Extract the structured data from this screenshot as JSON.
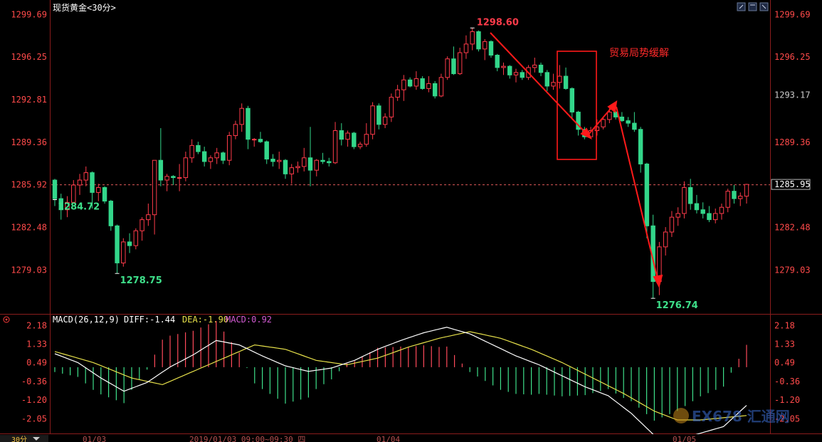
{
  "chart_data": [
    {
      "type": "candlestick",
      "title": "现货黄金<30分>",
      "ylim": [
        1276.0,
        1300.4
      ],
      "y_ticks": [
        "1299.69",
        "1296.25",
        "1292.81",
        "1289.36",
        "1285.92",
        "1282.48",
        "1279.03"
      ],
      "y_tick_values": [
        1299.69,
        1296.25,
        1292.81,
        1289.36,
        1285.92,
        1282.48,
        1279.03
      ],
      "right_ticks": [
        "1299.69",
        "1296.25",
        "1293.17",
        "1289.36",
        "1285.92",
        "1282.48",
        "1279.03"
      ],
      "right_tick_values": [
        1299.69,
        1296.25,
        1293.17,
        1289.36,
        1285.92,
        1282.48,
        1279.03
      ],
      "reference_value": 1285.92,
      "current_price": "1285.95",
      "current_price_value": 1285.95,
      "candles": [
        [
          1286.3,
          1286.4,
          1284.2,
          1284.8
        ],
        [
          1284.8,
          1285.2,
          1283.1,
          1283.9
        ],
        [
          1283.9,
          1285.0,
          1283.3,
          1284.5
        ],
        [
          1284.5,
          1286.3,
          1284.4,
          1285.9
        ],
        [
          1285.9,
          1286.8,
          1285.1,
          1286.3
        ],
        [
          1286.3,
          1287.4,
          1285.8,
          1286.9
        ],
        [
          1286.9,
          1287.0,
          1284.0,
          1285.3
        ],
        [
          1285.3,
          1286.0,
          1284.6,
          1285.7
        ],
        [
          1285.7,
          1285.8,
          1284.4,
          1284.6
        ],
        [
          1284.6,
          1284.7,
          1282.2,
          1282.6
        ],
        [
          1282.6,
          1282.7,
          1278.75,
          1279.6
        ],
        [
          1279.6,
          1281.6,
          1279.3,
          1281.3
        ],
        [
          1281.3,
          1282.0,
          1280.4,
          1281.0
        ],
        [
          1281.0,
          1282.4,
          1280.7,
          1282.2
        ],
        [
          1282.2,
          1283.3,
          1281.4,
          1283.1
        ],
        [
          1283.1,
          1284.4,
          1282.6,
          1283.5
        ],
        [
          1283.5,
          1286.4,
          1281.9,
          1287.9
        ],
        [
          1287.9,
          1290.5,
          1285.8,
          1286.3
        ],
        [
          1286.3,
          1286.8,
          1285.4,
          1286.6
        ],
        [
          1286.6,
          1286.7,
          1285.9,
          1286.5
        ],
        [
          1286.5,
          1287.6,
          1285.4,
          1286.5
        ],
        [
          1286.5,
          1288.6,
          1286.2,
          1288.1
        ],
        [
          1288.1,
          1289.6,
          1287.7,
          1289.1
        ],
        [
          1289.1,
          1289.4,
          1288.4,
          1288.6
        ],
        [
          1288.6,
          1289.0,
          1287.4,
          1287.8
        ],
        [
          1287.8,
          1288.3,
          1287.2,
          1288.1
        ],
        [
          1288.1,
          1288.9,
          1287.6,
          1288.5
        ],
        [
          1288.5,
          1288.6,
          1287.6,
          1287.9
        ],
        [
          1287.9,
          1290.2,
          1287.5,
          1289.9
        ],
        [
          1289.9,
          1291.1,
          1289.6,
          1290.8
        ],
        [
          1290.8,
          1292.5,
          1290.2,
          1292.1
        ],
        [
          1292.1,
          1292.3,
          1288.8,
          1289.6
        ],
        [
          1289.6,
          1289.7,
          1289.0,
          1289.6
        ],
        [
          1289.6,
          1290.2,
          1289.3,
          1289.4
        ],
        [
          1289.4,
          1289.5,
          1287.6,
          1288.0
        ],
        [
          1288.0,
          1288.4,
          1287.4,
          1287.8
        ],
        [
          1287.8,
          1288.6,
          1287.2,
          1287.9
        ],
        [
          1287.9,
          1288.0,
          1286.4,
          1286.8
        ],
        [
          1286.8,
          1287.6,
          1286.0,
          1287.3
        ],
        [
          1287.3,
          1287.8,
          1286.9,
          1287.4
        ],
        [
          1287.4,
          1288.9,
          1287.0,
          1288.1
        ],
        [
          1288.1,
          1290.6,
          1285.8,
          1287.1
        ],
        [
          1287.1,
          1288.0,
          1286.6,
          1287.9
        ],
        [
          1287.9,
          1288.5,
          1287.6,
          1287.8
        ],
        [
          1287.8,
          1288.1,
          1287.4,
          1287.7
        ],
        [
          1287.7,
          1291.0,
          1287.6,
          1290.3
        ],
        [
          1290.3,
          1290.9,
          1289.1,
          1289.6
        ],
        [
          1289.6,
          1290.3,
          1289.0,
          1290.1
        ],
        [
          1290.1,
          1290.2,
          1288.8,
          1289.0
        ],
        [
          1289.0,
          1289.4,
          1288.8,
          1289.2
        ],
        [
          1289.2,
          1290.9,
          1289.0,
          1290.0
        ],
        [
          1290.0,
          1292.6,
          1289.6,
          1292.3
        ],
        [
          1292.3,
          1292.5,
          1290.4,
          1290.8
        ],
        [
          1290.8,
          1291.7,
          1290.5,
          1291.4
        ],
        [
          1291.4,
          1293.3,
          1291.0,
          1293.0
        ],
        [
          1293.0,
          1294.0,
          1292.7,
          1293.6
        ],
        [
          1293.6,
          1294.8,
          1292.7,
          1294.4
        ],
        [
          1294.4,
          1294.6,
          1293.8,
          1293.9
        ],
        [
          1293.9,
          1295.1,
          1293.6,
          1294.5
        ],
        [
          1294.5,
          1294.7,
          1293.6,
          1293.7
        ],
        [
          1293.7,
          1294.7,
          1293.4,
          1294.1
        ],
        [
          1294.1,
          1294.3,
          1292.9,
          1293.1
        ],
        [
          1293.1,
          1294.9,
          1293.0,
          1294.6
        ],
        [
          1294.6,
          1296.3,
          1294.4,
          1296.1
        ],
        [
          1296.1,
          1297.1,
          1294.8,
          1294.9
        ],
        [
          1294.9,
          1297.0,
          1294.8,
          1296.6
        ],
        [
          1296.6,
          1298.0,
          1296.1,
          1297.3
        ],
        [
          1297.3,
          1298.6,
          1296.8,
          1298.3
        ],
        [
          1298.3,
          1298.4,
          1296.7,
          1296.9
        ],
        [
          1296.9,
          1297.7,
          1296.0,
          1297.5
        ],
        [
          1297.5,
          1297.6,
          1296.2,
          1296.4
        ],
        [
          1296.4,
          1296.5,
          1295.1,
          1295.4
        ],
        [
          1295.4,
          1295.8,
          1294.8,
          1295.5
        ],
        [
          1295.5,
          1295.6,
          1294.5,
          1294.8
        ],
        [
          1294.8,
          1295.3,
          1294.2,
          1295.0
        ],
        [
          1295.0,
          1295.2,
          1294.4,
          1294.6
        ],
        [
          1294.6,
          1295.6,
          1294.4,
          1295.4
        ],
        [
          1295.4,
          1296.2,
          1295.0,
          1295.6
        ],
        [
          1295.6,
          1295.8,
          1294.7,
          1295.0
        ],
        [
          1295.0,
          1295.2,
          1293.5,
          1293.9
        ],
        [
          1293.9,
          1294.9,
          1293.6,
          1294.2
        ],
        [
          1294.2,
          1295.6,
          1293.7,
          1294.7
        ],
        [
          1294.7,
          1295.4,
          1293.6,
          1293.7
        ],
        [
          1293.7,
          1293.8,
          1291.2,
          1291.8
        ],
        [
          1291.8,
          1291.9,
          1289.9,
          1290.4
        ],
        [
          1290.4,
          1290.6,
          1289.6,
          1289.8
        ],
        [
          1289.8,
          1290.6,
          1289.7,
          1290.3
        ],
        [
          1290.3,
          1291.2,
          1289.9,
          1290.6
        ],
        [
          1290.6,
          1291.4,
          1290.4,
          1291.2
        ],
        [
          1291.2,
          1292.1,
          1290.9,
          1291.8
        ],
        [
          1291.8,
          1291.9,
          1291.2,
          1291.4
        ],
        [
          1291.4,
          1291.8,
          1291.0,
          1291.1
        ],
        [
          1291.1,
          1291.4,
          1290.6,
          1290.9
        ],
        [
          1290.9,
          1291.8,
          1290.2,
          1290.4
        ],
        [
          1290.4,
          1290.6,
          1286.9,
          1287.6
        ],
        [
          1287.6,
          1287.7,
          1281.6,
          1282.6
        ],
        [
          1282.6,
          1283.5,
          1276.74,
          1278.1
        ],
        [
          1278.1,
          1281.3,
          1277.0,
          1280.9
        ],
        [
          1280.9,
          1282.5,
          1280.2,
          1282.1
        ],
        [
          1282.1,
          1283.8,
          1281.7,
          1283.3
        ],
        [
          1283.3,
          1284.1,
          1282.6,
          1283.6
        ],
        [
          1283.6,
          1286.2,
          1283.2,
          1285.7
        ],
        [
          1285.7,
          1286.4,
          1283.9,
          1284.4
        ],
        [
          1284.4,
          1285.1,
          1283.6,
          1283.9
        ],
        [
          1283.9,
          1284.5,
          1283.2,
          1283.6
        ],
        [
          1283.6,
          1284.2,
          1282.9,
          1283.1
        ],
        [
          1283.1,
          1284.0,
          1282.8,
          1283.6
        ],
        [
          1283.6,
          1284.4,
          1283.1,
          1284.1
        ],
        [
          1284.1,
          1285.6,
          1283.7,
          1285.4
        ],
        [
          1285.4,
          1285.9,
          1284.4,
          1284.8
        ],
        [
          1284.8,
          1285.3,
          1284.2,
          1285.0
        ],
        [
          1285.0,
          1286.0,
          1284.4,
          1285.95
        ]
      ],
      "annotations": {
        "high_label": "1298.60",
        "high_value": 1298.6,
        "low_label_1": "1278.75",
        "low_value_1": 1278.75,
        "mid_label": "1284.72",
        "mid_value": 1284.72,
        "low_label_2": "1276.74",
        "low_value_2": 1276.74,
        "note": "贸易局势缓解"
      },
      "x_labels": [
        "01/03",
        "2019/01/03 09:00~09:30 四",
        "01/04",
        "01/05"
      ],
      "period_badge": "30分"
    },
    {
      "type": "macd",
      "title": "MACD(26,12,9)",
      "diff_label": "DIFF:-1.44",
      "dea_label": "DEA:-1.90",
      "macd_label": "MACD:0.92",
      "diff_value": -1.44,
      "dea_value": -1.9,
      "macd_value": 0.92,
      "ylim": [
        -2.55,
        2.35
      ],
      "y_ticks": [
        "2.18",
        "1.33",
        "0.49",
        "-0.36",
        "-1.20",
        "-2.05"
      ],
      "y_tick_values": [
        2.18,
        1.33,
        0.49,
        -0.36,
        -1.2,
        -2.05
      ],
      "diff_points": [
        [
          0,
          0.9
        ],
        [
          6,
          0.5
        ],
        [
          12,
          -0.2
        ],
        [
          18,
          -0.8
        ],
        [
          24,
          -0.4
        ],
        [
          30,
          0.3
        ],
        [
          36,
          0.85
        ],
        [
          42,
          1.5
        ],
        [
          48,
          1.3
        ],
        [
          54,
          0.8
        ],
        [
          60,
          0.35
        ],
        [
          66,
          0.1
        ],
        [
          72,
          0.25
        ],
        [
          78,
          0.6
        ],
        [
          84,
          1.1
        ],
        [
          90,
          1.5
        ],
        [
          96,
          1.85
        ],
        [
          102,
          2.1
        ],
        [
          108,
          1.8
        ],
        [
          114,
          1.3
        ],
        [
          120,
          0.8
        ],
        [
          126,
          0.4
        ],
        [
          132,
          -0.1
        ],
        [
          138,
          -0.6
        ],
        [
          144,
          -1.0
        ],
        [
          150,
          -1.8
        ],
        [
          156,
          -2.8
        ],
        [
          162,
          -3.0
        ],
        [
          168,
          -2.7
        ],
        [
          174,
          -2.4
        ],
        [
          180,
          -1.44
        ]
      ],
      "dea_points": [
        [
          0,
          1.0
        ],
        [
          10,
          0.5
        ],
        [
          20,
          -0.2
        ],
        [
          28,
          -0.5
        ],
        [
          36,
          0.1
        ],
        [
          44,
          0.7
        ],
        [
          52,
          1.3
        ],
        [
          60,
          1.1
        ],
        [
          68,
          0.6
        ],
        [
          76,
          0.4
        ],
        [
          84,
          0.7
        ],
        [
          92,
          1.2
        ],
        [
          100,
          1.6
        ],
        [
          108,
          1.9
        ],
        [
          116,
          1.6
        ],
        [
          124,
          1.1
        ],
        [
          132,
          0.5
        ],
        [
          140,
          -0.2
        ],
        [
          148,
          -0.9
        ],
        [
          156,
          -1.7
        ],
        [
          162,
          -2.1
        ],
        [
          168,
          -2.1
        ],
        [
          174,
          -2.0
        ],
        [
          180,
          -1.9
        ]
      ],
      "x_labels": [
        "01/03",
        "2019/01/03 09:00~09:30 四",
        "01/04",
        "01/05"
      ]
    }
  ],
  "watermark": "EX678 汇通网"
}
